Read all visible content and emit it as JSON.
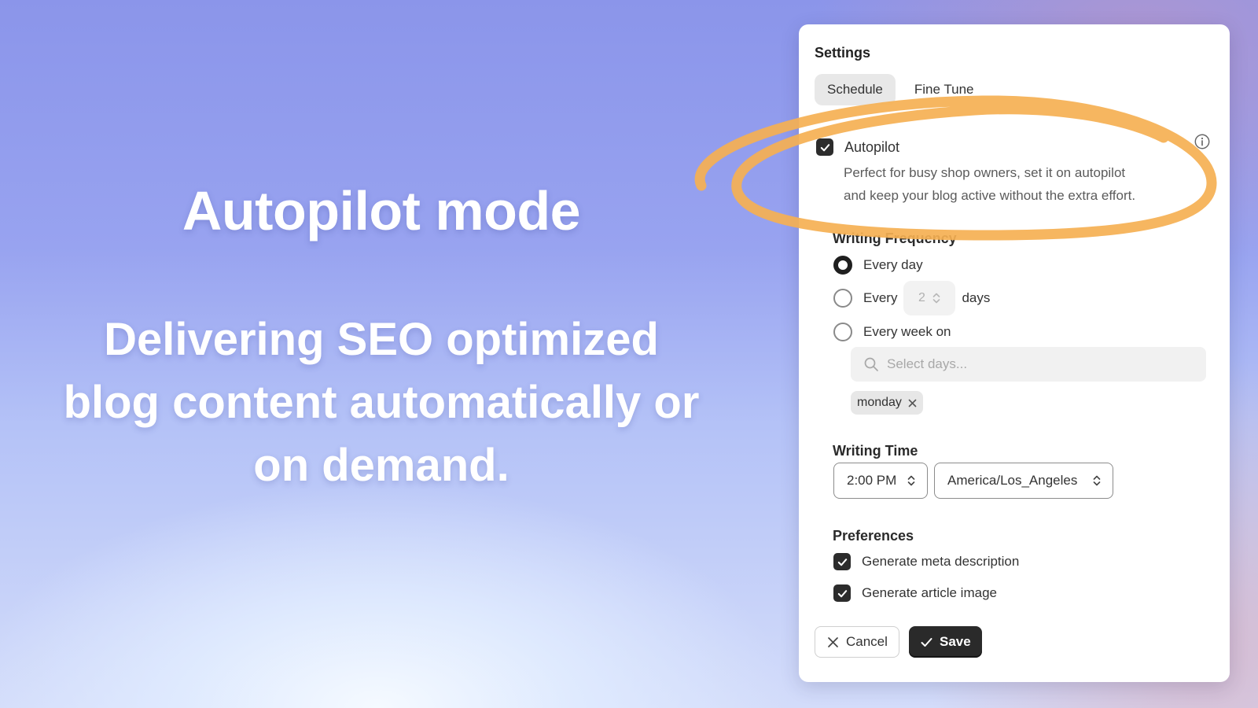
{
  "hero": {
    "title": "Autopilot mode",
    "subtitle_lines": [
      "Delivering SEO optimized",
      "blog content automatically or",
      "on demand."
    ]
  },
  "settings": {
    "title": "Settings",
    "tabs": [
      {
        "label": "Schedule",
        "active": true
      },
      {
        "label": "Fine Tune",
        "active": false
      }
    ],
    "autopilot": {
      "label": "Autopilot",
      "checked": true,
      "description_lines": [
        "Perfect for busy shop owners, set it on autopilot",
        "and keep your blog active without the extra effort."
      ]
    },
    "writing_frequency": {
      "heading": "Writing Frequency",
      "options": {
        "every_day": "Every day",
        "every_n_prefix": "Every",
        "every_n_value": "2",
        "every_n_suffix": "days",
        "every_week": "Every week on"
      },
      "selected": "every_day",
      "days_placeholder": "Select days...",
      "selected_days": [
        "monday"
      ]
    },
    "writing_time": {
      "heading": "Writing Time",
      "time": "2:00 PM",
      "timezone": "America/Los_Angeles"
    },
    "preferences": {
      "heading": "Preferences",
      "items": [
        {
          "label": "Generate meta description",
          "checked": true
        },
        {
          "label": "Generate article image",
          "checked": true
        }
      ]
    },
    "buttons": {
      "cancel": "Cancel",
      "save": "Save"
    }
  },
  "colors": {
    "highlight": "#f5b052",
    "dark": "#2a2a2a"
  }
}
